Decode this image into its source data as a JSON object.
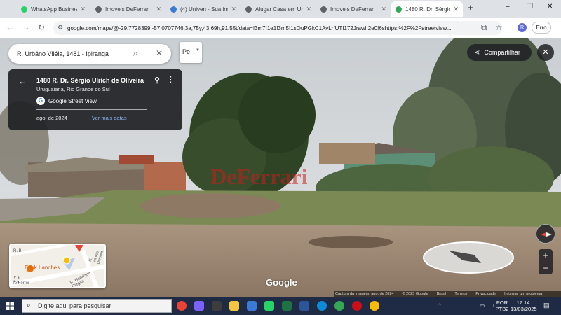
{
  "browser": {
    "tabs": [
      {
        "label": "WhatsApp Business",
        "color": "#25d366",
        "active": false
      },
      {
        "label": "Imoveis DeFerrari",
        "color": "#5f6368",
        "active": false
      },
      {
        "label": "(4) Univen - Sua im",
        "color": "#3a7bd5",
        "active": false
      },
      {
        "label": "Alugar Casa em Ur",
        "color": "#5f6368",
        "active": false
      },
      {
        "label": "Imoveis DeFerrari",
        "color": "#5f6368",
        "active": false
      },
      {
        "label": "1480 R. Dr. Sérgio",
        "color": "#34a853",
        "active": true
      }
    ],
    "new_tab": "+",
    "url": "google.com/maps/@-29.7728399,-57.0707746,3a,75y,43.69h,91.55t/data=!3m7!1e1!3m5!1sOuPGkC1AvLrfUTI172Jrawl!2e0!6shttps:%2F%2Fstreetview...",
    "profile_initial": "R",
    "error_label": "Erro",
    "window_controls": {
      "minimize": "–",
      "maximize": "❐",
      "close": "✕"
    }
  },
  "maps": {
    "search_value": "R. Urbãno Viléla, 1481 - Ipiranga",
    "peek_label": "Pe",
    "share_label": "Compartilhar",
    "info": {
      "address": "1480 R. Dr. Sérgio Ulrich de Oliveira",
      "city": "Uruguaiana, Rio Grande do Sul",
      "source": "Google Street View",
      "date": "ago. de 2024",
      "more_dates": "Ver mais datas"
    },
    "minimap": {
      "place": "Erick Lanches",
      "streets": [
        "R. Henrique Piegas",
        "R. Santos Dumont",
        "R. B",
        "Ip Ferrei"
      ]
    },
    "watermark": "DeFerrari",
    "google_logo": "Google",
    "attribution": [
      "Captura da imagem: ago. de 2024",
      "© 2025 Google",
      "Brasil",
      "Termos",
      "Privacidade",
      "Informar um problema"
    ]
  },
  "taskbar": {
    "search_placeholder": "Digite aqui para pesquisar",
    "lang_top": "POR",
    "lang_bottom": "PTB2",
    "time": "17:14",
    "date": "13/03/2025"
  }
}
